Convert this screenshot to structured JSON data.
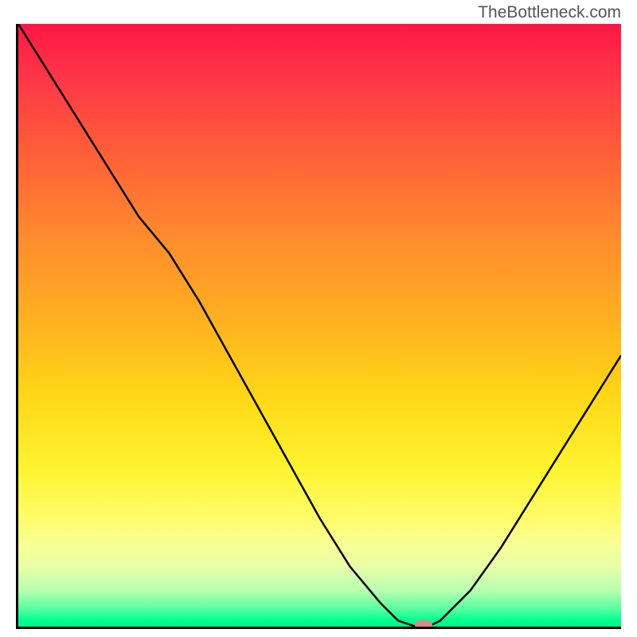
{
  "watermark": "TheBottleneck.com",
  "chart_data": {
    "type": "line",
    "title": "",
    "xlabel": "",
    "ylabel": "",
    "x": [
      0,
      5,
      10,
      15,
      20,
      25,
      30,
      35,
      40,
      45,
      50,
      55,
      60,
      63,
      66,
      68,
      70,
      75,
      80,
      85,
      90,
      95,
      100
    ],
    "y": [
      100,
      92,
      84,
      76,
      68,
      62,
      54,
      45,
      36,
      27,
      18,
      10,
      4,
      1,
      0,
      0,
      1,
      6,
      13,
      21,
      29,
      37,
      45
    ],
    "marker": {
      "x": 67,
      "y": 0
    },
    "xlim": [
      0,
      100
    ],
    "ylim": [
      0,
      100
    ],
    "background": "red-yellow-green vertical gradient",
    "description": "V-shaped bottleneck curve on gradient background; minimum near x≈67"
  }
}
